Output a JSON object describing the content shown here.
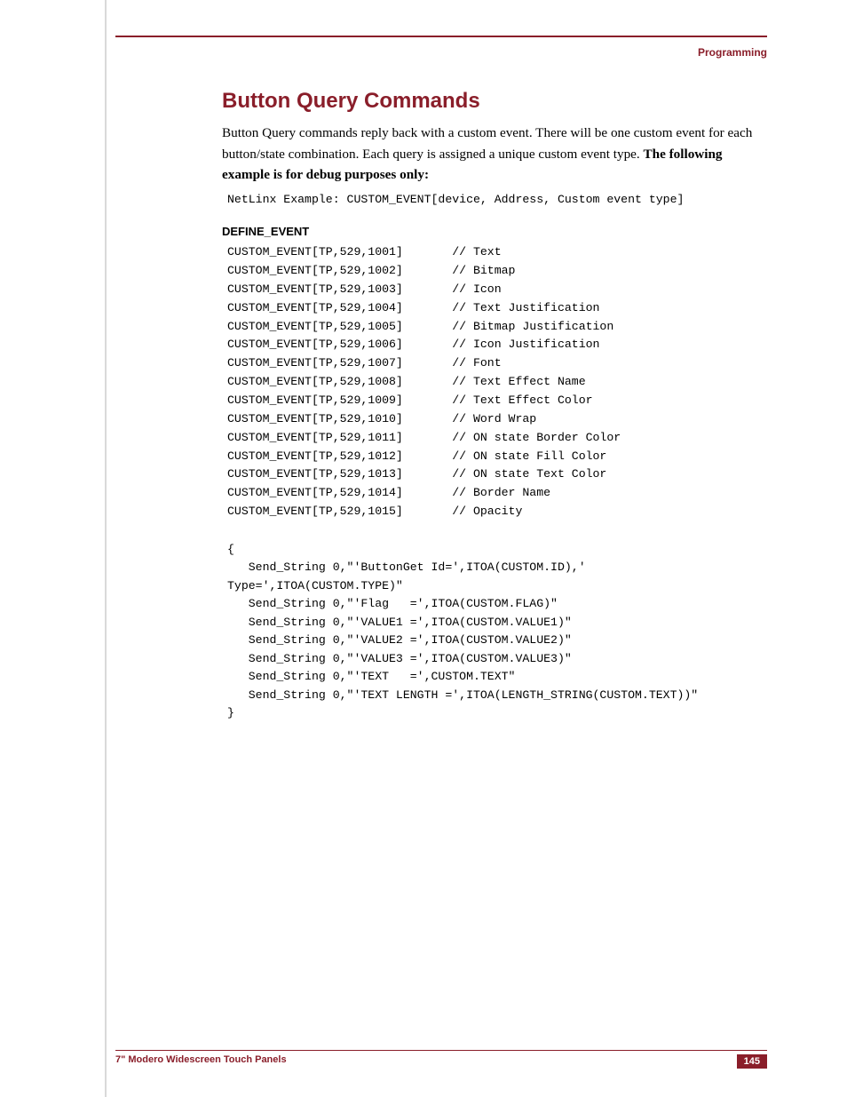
{
  "header": {
    "section_label": "Programming"
  },
  "title": "Button Query Commands",
  "intro": {
    "line1": "Button Query commands reply back with a custom event. There will be one custom event for each",
    "line2a": "button/state combination. Each query is assigned a unique custom event type. ",
    "line2b": "The following",
    "line3b": "example is for debug purposes only:"
  },
  "example_line": "NetLinx Example: CUSTOM_EVENT[device, Address, Custom event type]",
  "subheading": "DEFINE_EVENT",
  "events": [
    {
      "def": "CUSTOM_EVENT[TP,529,1001]",
      "comment": "// Text"
    },
    {
      "def": "CUSTOM_EVENT[TP,529,1002]",
      "comment": "// Bitmap"
    },
    {
      "def": "CUSTOM_EVENT[TP,529,1003]",
      "comment": "// Icon"
    },
    {
      "def": "CUSTOM_EVENT[TP,529,1004]",
      "comment": "// Text Justification"
    },
    {
      "def": "CUSTOM_EVENT[TP,529,1005]",
      "comment": "// Bitmap Justification"
    },
    {
      "def": "CUSTOM_EVENT[TP,529,1006]",
      "comment": "// Icon Justification"
    },
    {
      "def": "CUSTOM_EVENT[TP,529,1007]",
      "comment": "// Font"
    },
    {
      "def": "CUSTOM_EVENT[TP,529,1008]",
      "comment": "// Text Effect Name"
    },
    {
      "def": "CUSTOM_EVENT[TP,529,1009]",
      "comment": "// Text Effect Color"
    },
    {
      "def": "CUSTOM_EVENT[TP,529,1010]",
      "comment": "// Word Wrap"
    },
    {
      "def": "CUSTOM_EVENT[TP,529,1011]",
      "comment": "// ON state Border Color"
    },
    {
      "def": "CUSTOM_EVENT[TP,529,1012]",
      "comment": "// ON state Fill Color"
    },
    {
      "def": "CUSTOM_EVENT[TP,529,1013]",
      "comment": "// ON state Text Color"
    },
    {
      "def": "CUSTOM_EVENT[TP,529,1014]",
      "comment": "// Border Name"
    },
    {
      "def": "CUSTOM_EVENT[TP,529,1015]",
      "comment": "// Opacity"
    }
  ],
  "code_block": "{\n   Send_String 0,\"'ButtonGet Id=',ITOA(CUSTOM.ID),'\nType=',ITOA(CUSTOM.TYPE)\"\n   Send_String 0,\"'Flag   =',ITOA(CUSTOM.FLAG)\"\n   Send_String 0,\"'VALUE1 =',ITOA(CUSTOM.VALUE1)\"\n   Send_String 0,\"'VALUE2 =',ITOA(CUSTOM.VALUE2)\"\n   Send_String 0,\"'VALUE3 =',ITOA(CUSTOM.VALUE3)\"\n   Send_String 0,\"'TEXT   =',CUSTOM.TEXT\"\n   Send_String 0,\"'TEXT LENGTH =',ITOA(LENGTH_STRING(CUSTOM.TEXT))\"\n}",
  "footer": {
    "title": "7\" Modero Widescreen Touch Panels",
    "page": "145"
  }
}
